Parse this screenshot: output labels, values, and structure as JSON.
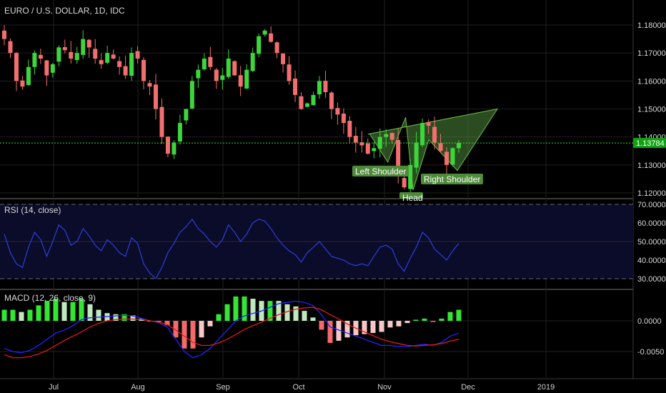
{
  "header": {
    "symbol_title": "EURO / U.S. DOLLAR, 1D, IDC"
  },
  "panes": {
    "rsi_title": "RSI (14, close)",
    "macd_title": "MACD (12, 26, close, 9)"
  },
  "price_axis": {
    "ticks": [
      1.18,
      1.17,
      1.16,
      1.15,
      1.14,
      1.13,
      1.12
    ],
    "tick_labels": [
      "1.18000",
      "1.17000",
      "1.16000",
      "1.15000",
      "1.14000",
      "1.13000",
      "1.12000"
    ],
    "last_price": 1.13784,
    "last_price_label": "1.13784"
  },
  "rsi_axis": {
    "ticks": [
      70,
      60,
      50,
      40,
      30
    ],
    "tick_labels": [
      "70.0000",
      "60.0000",
      "50.0000",
      "40.0000",
      "30.0000"
    ]
  },
  "macd_axis": {
    "ticks": [
      0,
      -0.005
    ],
    "tick_labels": [
      "0.0000",
      "-0.0050"
    ]
  },
  "time_axis": {
    "labels": [
      "Jul",
      "Aug",
      "Sep",
      "Oct",
      "Nov",
      "Dec",
      "2019"
    ]
  },
  "annotations": {
    "left_shoulder": "Left Shoulder",
    "head": "Head",
    "right_shoulder": "Right Shoulder"
  },
  "colors": {
    "up": "#3cd63c",
    "down": "#f36e6e",
    "rsi_line": "#2b3ccc",
    "macd_line": "#2323ff",
    "signal_line": "#e01b1b",
    "hist_up_strong": "#33e633",
    "hist_up_weak": "#bfe8bf",
    "hist_down_strong": "#f46a6a",
    "hist_down_weak": "#f7c7c7",
    "pattern_fill": "#4f8a3a",
    "last_price_tag": "#11a011"
  },
  "chart_data": [
    {
      "type": "candlestick",
      "title": "EURO / U.S. DOLLAR, 1D, IDC",
      "x_labels": [
        "Jul",
        "Aug",
        "Sep",
        "Oct",
        "Nov",
        "Dec",
        "2019"
      ],
      "y_range": [
        1.117,
        1.182
      ],
      "description_points": {
        "close_path": [
          1.175,
          1.17,
          1.16,
          1.158,
          1.165,
          1.17,
          1.168,
          1.162,
          1.166,
          1.172,
          1.171,
          1.168,
          1.17,
          1.175,
          1.172,
          1.168,
          1.166,
          1.17,
          1.168,
          1.165,
          1.162,
          1.17,
          1.168,
          1.16,
          1.158,
          1.15,
          1.14,
          1.134,
          1.138,
          1.145,
          1.15,
          1.16,
          1.164,
          1.168,
          1.165,
          1.16,
          1.162,
          1.168,
          1.162,
          1.158,
          1.164,
          1.17,
          1.176,
          1.178,
          1.174,
          1.17,
          1.166,
          1.16,
          1.155,
          1.15,
          1.152,
          1.155,
          1.16,
          1.156,
          1.15,
          1.148,
          1.145,
          1.14,
          1.138,
          1.137,
          1.134,
          1.136,
          1.14,
          1.141,
          1.139,
          1.126,
          1.122,
          1.13,
          1.138,
          1.145,
          1.144,
          1.138,
          1.135,
          1.13,
          1.136,
          1.13784
        ],
        "last_price": 1.13784
      }
    },
    {
      "type": "line",
      "title": "RSI (14, close)",
      "ylim": [
        30,
        70
      ],
      "guide_levels": [
        70,
        50,
        30
      ],
      "series": [
        {
          "name": "RSI (14, close)",
          "values": [
            54,
            44,
            38,
            36,
            47,
            55,
            51,
            42,
            50,
            59,
            56,
            48,
            50,
            57,
            53,
            48,
            45,
            51,
            48,
            44,
            42,
            52,
            49,
            38,
            33,
            30,
            36,
            44,
            49,
            55,
            58,
            62,
            57,
            54,
            50,
            47,
            51,
            59,
            55,
            50,
            54,
            60,
            62,
            61,
            57,
            52,
            48,
            45,
            43,
            39,
            44,
            47,
            50,
            46,
            42,
            41,
            40,
            38,
            37,
            38,
            37,
            42,
            47,
            48,
            46,
            38,
            34,
            41,
            47,
            55,
            52,
            46,
            43,
            40,
            45,
            49
          ]
        }
      ]
    },
    {
      "type": "line+bar",
      "title": "MACD (12, 26, close, 9)",
      "ylim": [
        -0.007,
        0.004
      ],
      "series": [
        {
          "name": "MACD",
          "values": [
            -0.0045,
            -0.005,
            -0.0052,
            -0.0048,
            -0.004,
            -0.003,
            -0.002,
            -0.0015,
            -0.0008,
            0.0002,
            0.0005,
            0.0006,
            0.0007,
            0.0008,
            0.0009,
            0.0008,
            0.0004,
            0.0,
            -0.0003,
            -0.001,
            -0.003,
            -0.005,
            -0.006,
            -0.0055,
            -0.0045,
            -0.003,
            -0.0015,
            0.0,
            0.0008,
            0.0012,
            0.0016,
            0.0022,
            0.0028,
            0.003,
            0.0032,
            0.003,
            0.0025,
            0.001,
            -0.001,
            -0.0015,
            -0.002,
            -0.0025,
            -0.003,
            -0.0035,
            -0.004,
            -0.004,
            -0.0042,
            -0.0042,
            -0.004,
            -0.0038,
            -0.004,
            -0.0035,
            -0.0025,
            -0.002
          ]
        },
        {
          "name": "Signal",
          "values": [
            -0.0055,
            -0.006,
            -0.006,
            -0.0058,
            -0.0054,
            -0.0048,
            -0.004,
            -0.0032,
            -0.0025,
            -0.0018,
            -0.001,
            -0.0004,
            0.0,
            0.0002,
            0.0003,
            0.0003,
            0.0002,
            0.0,
            -0.0002,
            -0.0006,
            -0.0015,
            -0.0025,
            -0.0035,
            -0.004,
            -0.004,
            -0.0036,
            -0.003,
            -0.0022,
            -0.0014,
            -0.0008,
            -0.0002,
            0.0004,
            0.001,
            0.0015,
            0.0019,
            0.0021,
            0.0022,
            0.0018,
            0.001,
            0.0003,
            -0.0005,
            -0.0012,
            -0.0018,
            -0.0024,
            -0.003,
            -0.0034,
            -0.0037,
            -0.004,
            -0.0041,
            -0.004,
            -0.0039,
            -0.0037,
            -0.0033,
            -0.003
          ]
        }
      ]
    }
  ]
}
